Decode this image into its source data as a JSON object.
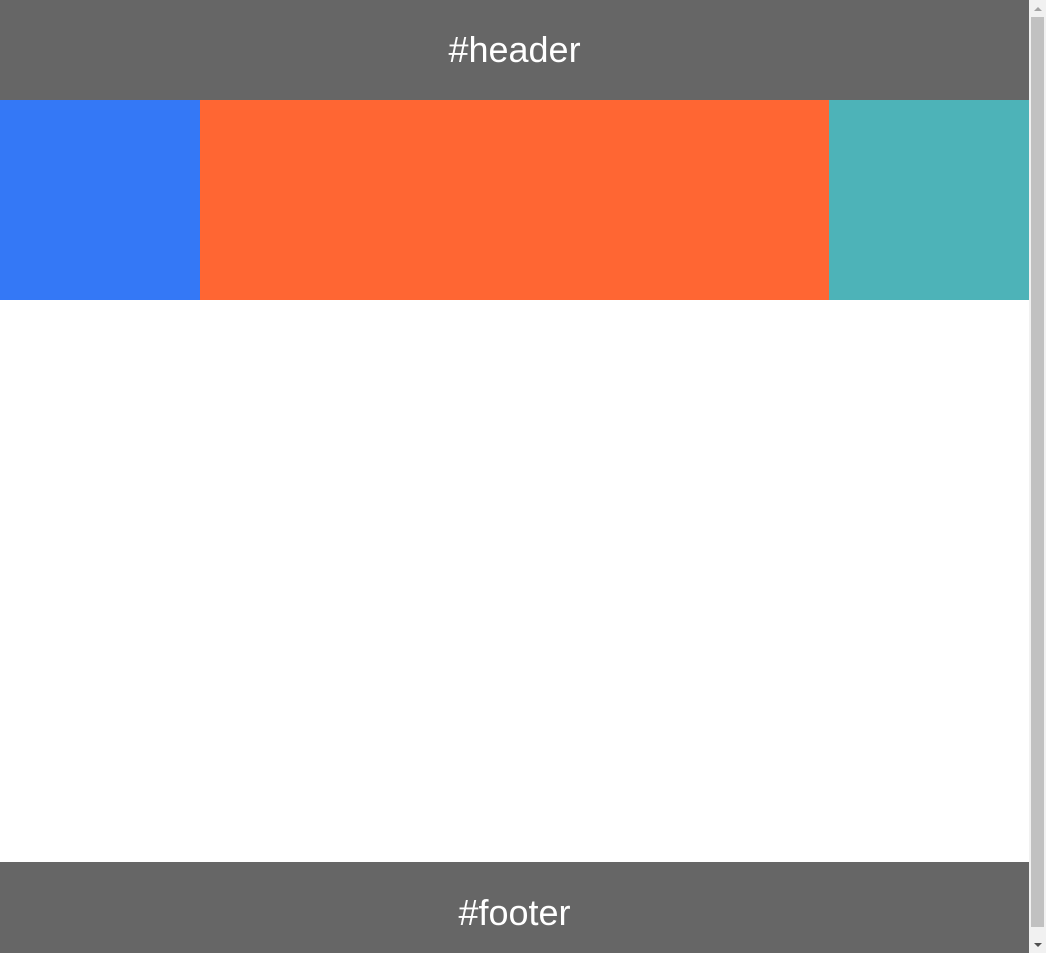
{
  "header": {
    "text": "#header",
    "background": "#666666"
  },
  "columns": {
    "left": {
      "background": "#3478f6"
    },
    "main": {
      "background": "#ff6633"
    },
    "right": {
      "background": "#4db3b8"
    }
  },
  "footer": {
    "text": "#footer",
    "background": "#666666"
  },
  "scrollbar": {
    "up_icon": "arrow-up-icon",
    "down_icon": "arrow-down-icon"
  }
}
